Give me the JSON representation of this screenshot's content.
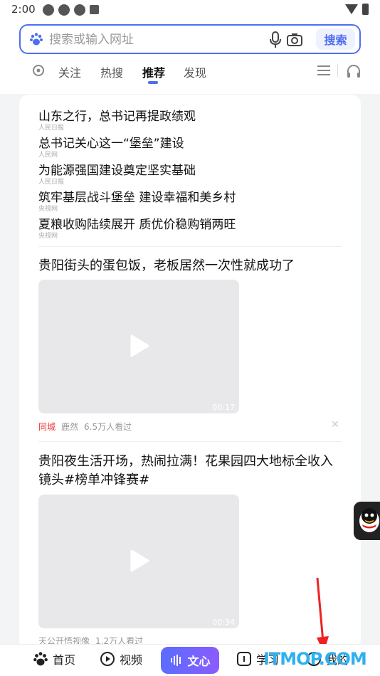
{
  "status_bar": {
    "time": "2:00"
  },
  "search": {
    "placeholder": "搜索或输入网址",
    "button_label": "搜索"
  },
  "tabs": [
    {
      "label": "关注"
    },
    {
      "label": "热搜"
    },
    {
      "label": "推荐",
      "active": true
    },
    {
      "label": "发现"
    }
  ],
  "news": [
    {
      "title": "山东之行，总书记再提政绩观",
      "source": "人民日报"
    },
    {
      "title": "总书记关心这一“堡垒”建设",
      "source": "人民网"
    },
    {
      "title": "为能源强国建设奠定坚实基础",
      "source": "人民日报"
    },
    {
      "title": "筑牢基层战斗堡垒 建设幸福和美乡村",
      "source": "央视网"
    },
    {
      "title": "夏粮收购陆续展开 质优价稳购销两旺",
      "source": "央视网"
    }
  ],
  "videos": [
    {
      "title": "贵阳街头的蛋包饭，老板居然一次性就成功了",
      "duration": "00:17",
      "tag": "同城",
      "author": "鹿然",
      "views": "6.5万人看过"
    },
    {
      "title": "贵阳夜生活开场，热闹拉满！花果园四大地标全收入镜头#榜单冲锋赛#",
      "duration": "00:34",
      "author": "天公开悟视像",
      "views": "1.2万人看过"
    }
  ],
  "bottom_nav": {
    "home": "首页",
    "video": "视频",
    "wenxin": "文心",
    "learn": "学习",
    "mine": "我的"
  },
  "watermark": "ITMOP.COM",
  "colors": {
    "accent": "#4e6ef2",
    "red_tag": "#ee3333",
    "watermark": "#2fb0f0"
  }
}
